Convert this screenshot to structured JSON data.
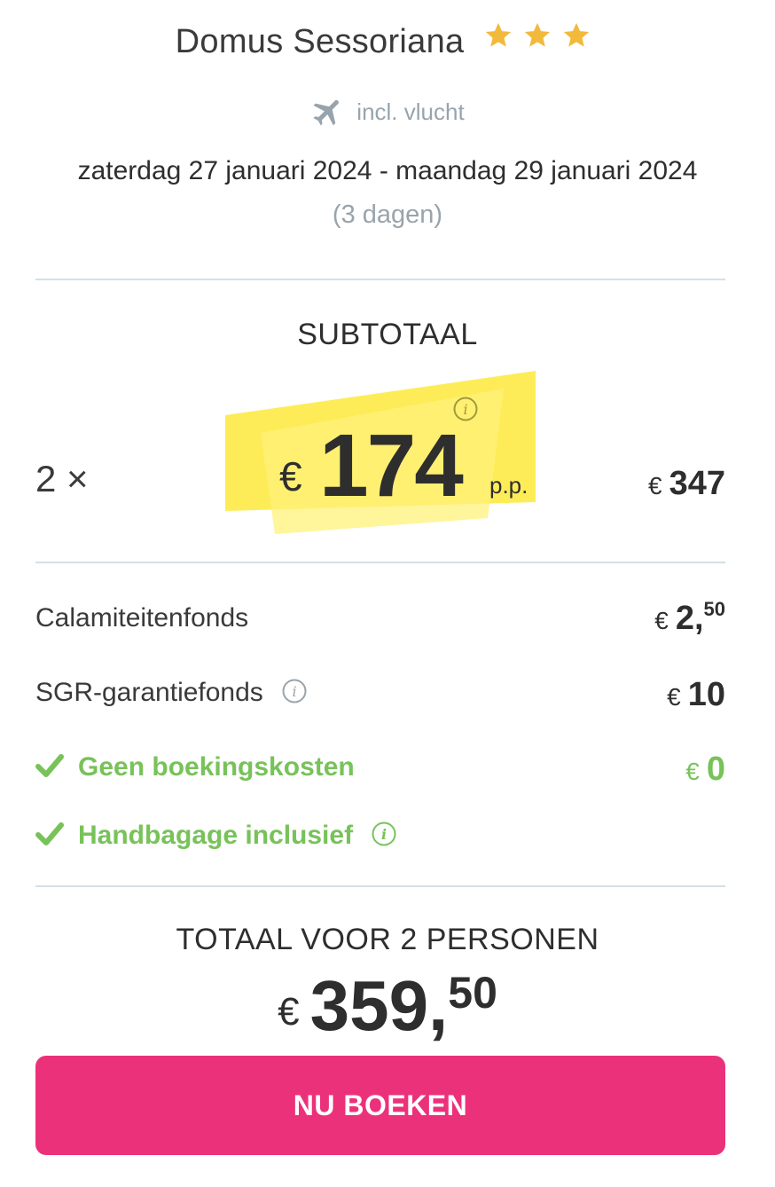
{
  "hotel": {
    "name": "Domus Sessoriana",
    "stars": 3,
    "star_color": "#f2b93b"
  },
  "flight": {
    "label": "incl. vlucht",
    "icon": "airplane-icon"
  },
  "trip": {
    "dates": "zaterdag 27 januari 2024 - maandag 29 januari 2024",
    "duration": "(3 dagen)"
  },
  "subtotal": {
    "title": "SUBTOTAAL",
    "quantity": "2 ×",
    "currency": "€",
    "price_pp": "174",
    "pp_label": "p.p.",
    "row_total": "347",
    "highlight_color": "#fde93a"
  },
  "fees": [
    {
      "label": "Calamiteitenfonds",
      "currency": "€",
      "amount": "2,",
      "cents": "50"
    },
    {
      "label": "SGR-garantiefonds",
      "currency": "€",
      "amount": "10"
    }
  ],
  "perks": [
    {
      "label": "Geen boekingskosten",
      "currency": "€",
      "amount": "0"
    },
    {
      "label": "Handbagage inclusief"
    }
  ],
  "total": {
    "title": "TOTAAL VOOR 2 PERSONEN",
    "currency": "€",
    "amount": "359,",
    "cents": "50"
  },
  "cta": {
    "label": "NU BOEKEN",
    "color": "#ec317b"
  },
  "colors": {
    "green": "#78c25a",
    "divider": "#d3e0e6",
    "muted": "#98a4ad"
  }
}
